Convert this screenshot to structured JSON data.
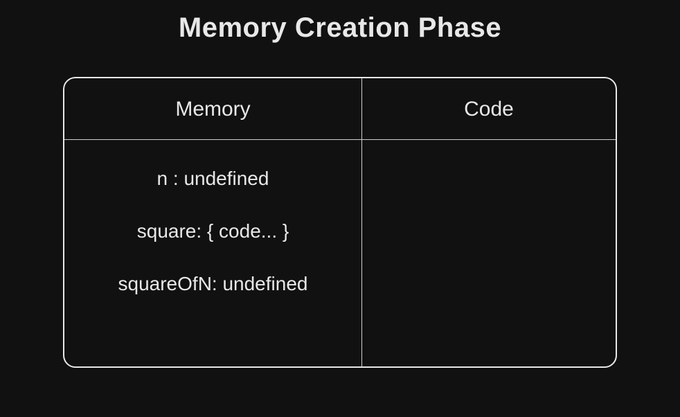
{
  "title": "Memory Creation Phase",
  "columns": {
    "memory": {
      "header": "Memory",
      "entries": [
        "n : undefined",
        "square: { code... }",
        "squareOfN: undefined"
      ]
    },
    "code": {
      "header": "Code",
      "entries": []
    }
  }
}
